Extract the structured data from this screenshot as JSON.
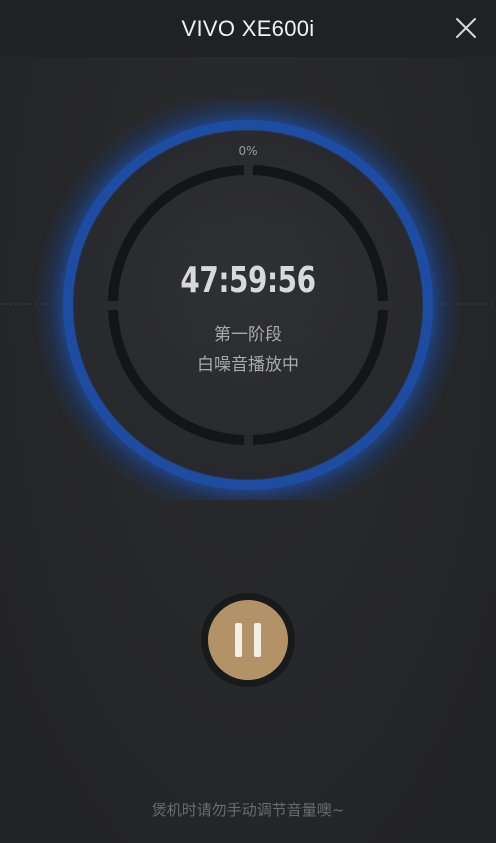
{
  "header": {
    "title": "VIVO XE600i",
    "close_icon": "close-icon"
  },
  "dial": {
    "progress_label": "0%",
    "progress_fraction": 0.0,
    "timer": "47:59:56",
    "stage": "第一阶段",
    "status": "白噪音播放中",
    "accent_color": "#1d4fa8"
  },
  "controls": {
    "pause_icon": "pause-icon",
    "pause_color": "#b49268"
  },
  "footer": {
    "hint": "煲机时请勿手动调节音量噢~"
  }
}
